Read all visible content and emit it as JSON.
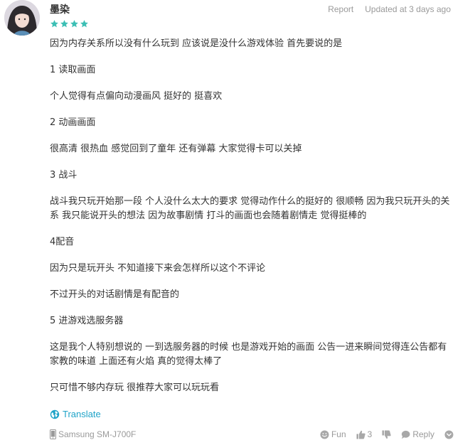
{
  "review": {
    "author": "墨染",
    "rating": 4,
    "max_rating": 5,
    "report_label": "Report",
    "updated_label": "Updated at 3 days ago",
    "paragraphs": [
      "因为内存关系所以没有什么玩到 应该说是没什么游戏体验 首先要说的是",
      "1 读取画面",
      "个人觉得有点偏向动漫画风 挺好的 挺喜欢",
      "2 动画画面",
      "很高清 很热血 感觉回到了童年 还有弹幕 大家觉得卡可以关掉",
      "3 战斗",
      "战斗我只玩开始那一段 个人没什么太大的要求 觉得动作什么的挺好的 很顺畅 因为我只玩开头的关系 我只能说开头的想法 因为故事剧情 打斗的画面也会随着剧情走 觉得挺棒的",
      "4配音",
      "因为只是玩开头 不知道接下来会怎样所以这个不评论",
      "不过开头的对话剧情是有配音的",
      "5 进游戏选服务器",
      "这是我个人特别想说的 一到选服务器的时候 也是游戏开始的画面 公告一进来瞬间觉得连公告都有家教的味道 上面还有火焰 真的觉得太棒了",
      "只可惜不够内存玩 很推荐大家可以玩玩看"
    ],
    "translate_label": "Translate",
    "device": "Samsung SM-J700F",
    "fun_label": "Fun",
    "like_count": "3",
    "reply_label": "Reply"
  },
  "colors": {
    "star": "#3dbfb5",
    "link": "#1fa3c8",
    "muted": "#9a9a9a",
    "text": "#333333"
  },
  "icons": {
    "avatar": "user-avatar-photo",
    "star": "star-icon",
    "translate": "globe-icon",
    "device": "phone-icon",
    "fun": "smiley-icon",
    "like": "thumbs-up-icon",
    "dislike": "thumbs-down-icon",
    "reply": "speech-bubble-icon",
    "more": "chevron-down-icon"
  }
}
